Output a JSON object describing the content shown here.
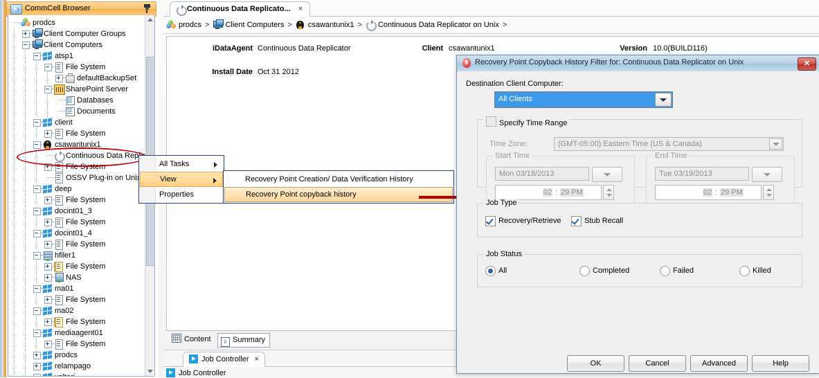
{
  "left_panel": {
    "title": "CommCell Browser",
    "pin_icon": "pin-icon",
    "tree": [
      {
        "label": "prodcs",
        "depth": 0,
        "icon": "commcell-icon",
        "expander": "none"
      },
      {
        "label": "Client Computer Groups",
        "depth": 1,
        "icon": "computer-group-icon",
        "expander": "plus"
      },
      {
        "label": "Client Computers",
        "depth": 1,
        "icon": "computer-group-icon",
        "expander": "minus"
      },
      {
        "label": "atsp1",
        "depth": 2,
        "icon": "windows-client-icon",
        "expander": "minus"
      },
      {
        "label": "File System",
        "depth": 3,
        "icon": "file-system-icon",
        "expander": "minus"
      },
      {
        "label": "defaultBackupSet",
        "depth": 4,
        "icon": "backupset-icon",
        "expander": "plus"
      },
      {
        "label": "SharePoint Server",
        "depth": 3,
        "icon": "sharepoint-icon",
        "expander": "minus"
      },
      {
        "label": "Databases",
        "depth": 4,
        "icon": "database-icon",
        "expander": "none"
      },
      {
        "label": "Documents",
        "depth": 4,
        "icon": "documents-icon",
        "expander": "none"
      },
      {
        "label": "client",
        "depth": 2,
        "icon": "windows-client-icon",
        "expander": "minus"
      },
      {
        "label": "File System",
        "depth": 3,
        "icon": "file-system-icon",
        "expander": "plus"
      },
      {
        "label": "csawantunix1",
        "depth": 2,
        "icon": "linux-client-icon",
        "expander": "minus"
      },
      {
        "label": "Continuous Data Replicator",
        "depth": 3,
        "icon": "cdr-icon",
        "expander": "none"
      },
      {
        "label": "File System",
        "depth": 3,
        "icon": "file-system-icon",
        "expander": "plus"
      },
      {
        "label": "OSSV Plug-in on Unix",
        "depth": 3,
        "icon": "file-system-icon",
        "expander": "none"
      },
      {
        "label": "deep",
        "depth": 2,
        "icon": "windows-client-icon",
        "expander": "minus"
      },
      {
        "label": "File System",
        "depth": 3,
        "icon": "file-system-icon",
        "expander": "plus"
      },
      {
        "label": "docint01_3",
        "depth": 2,
        "icon": "windows-client-icon",
        "expander": "minus"
      },
      {
        "label": "File System",
        "depth": 3,
        "icon": "file-system-icon",
        "expander": "plus"
      },
      {
        "label": "docint01_4",
        "depth": 2,
        "icon": "windows-client-icon",
        "expander": "minus"
      },
      {
        "label": "File System",
        "depth": 3,
        "icon": "file-system-icon",
        "expander": "plus"
      },
      {
        "label": "hfiler1",
        "depth": 2,
        "icon": "filer-icon",
        "expander": "minus"
      },
      {
        "label": "File System",
        "depth": 3,
        "icon": "file-system-yellow-icon",
        "expander": "plus"
      },
      {
        "label": "NAS",
        "depth": 3,
        "icon": "nas-icon",
        "expander": "plus"
      },
      {
        "label": "ma01",
        "depth": 2,
        "icon": "windows-client-icon",
        "expander": "minus"
      },
      {
        "label": "File System",
        "depth": 3,
        "icon": "file-system-icon",
        "expander": "plus"
      },
      {
        "label": "ma02",
        "depth": 2,
        "icon": "windows-client-icon",
        "expander": "minus"
      },
      {
        "label": "File System",
        "depth": 3,
        "icon": "file-system-yellow-icon",
        "expander": "plus"
      },
      {
        "label": "mediaagent01",
        "depth": 2,
        "icon": "windows-client-icon",
        "expander": "minus"
      },
      {
        "label": "File System",
        "depth": 3,
        "icon": "file-system-icon",
        "expander": "plus"
      },
      {
        "label": "prodcs",
        "depth": 2,
        "icon": "windows-client-icon",
        "expander": "plus"
      },
      {
        "label": "relampago",
        "depth": 2,
        "icon": "windows-client-icon",
        "expander": "plus"
      },
      {
        "label": "valtari",
        "depth": 2,
        "icon": "windows-client-icon",
        "expander": "minus"
      }
    ]
  },
  "main": {
    "tab": {
      "label": "Continuous Data Replicato...",
      "close": "×",
      "icon": "cdr-icon"
    },
    "breadcrumb": [
      {
        "label": "prodcs",
        "icon": "commcell-icon"
      },
      {
        "label": "Client Computers",
        "icon": "computer-group-icon"
      },
      {
        "label": "csawantunix1",
        "icon": "linux-client-icon"
      },
      {
        "label": "Continuous Data Replicator on Unix",
        "icon": "cdr-icon"
      }
    ],
    "breadcrumb_separator": ">",
    "details": {
      "idataagent_label": "iDataAgent",
      "idataagent_value": "Continuous Data Replicator",
      "install_date_label": "Install Date",
      "install_date_value": "Oct 31 2012",
      "client_label": "Client",
      "client_value": "csawantunix1",
      "version_label": "Version",
      "version_value": "10.0(BUILD116)"
    },
    "content_tabs": [
      {
        "label": "Content",
        "icon": "grid-icon",
        "selected": false
      },
      {
        "label": "Summary",
        "icon": "summary-icon",
        "selected": true
      }
    ],
    "job_controller_tab": {
      "label": "Job Controller",
      "close": "×",
      "icon": "play-icon"
    },
    "job_controller_bottom": {
      "label": "Job Controller",
      "icon": "play-icon"
    }
  },
  "context_menu_1": {
    "items": [
      {
        "label": "All Tasks",
        "submenu": true,
        "highlighted": false
      },
      {
        "label": "View",
        "submenu": true,
        "highlighted": true
      },
      {
        "label": "Properties",
        "submenu": false,
        "highlighted": false
      }
    ]
  },
  "context_menu_2": {
    "items": [
      {
        "label": "Recovery Point Creation/ Data Verification History",
        "highlighted": false
      },
      {
        "label": "Recovery Point copyback history",
        "highlighted": true
      }
    ]
  },
  "dialog": {
    "title": "Recovery Point Copyback History Filter for: Continuous Data Replicator on Unix",
    "icon": "commvault-icon",
    "close_label": "✕",
    "destination_label": "Destination Client Computer:",
    "destination_value": "All Clients",
    "specify_time_range": {
      "label": "Specify Time Range",
      "checked": false
    },
    "time_zone_label": "Time Zone:",
    "time_zone_value": "(GMT-05:00) Eastern Time (US & Canada)",
    "start_time": {
      "group_label": "Start Time",
      "date": "Mon 03/18/2013",
      "hour": "02",
      "minute": "29 PM",
      "separator": ":"
    },
    "end_time": {
      "group_label": "End Time",
      "date": "Tue 03/19/2013",
      "hour": "02",
      "minute": "29 PM",
      "separator": ":"
    },
    "job_type": {
      "group_label": "Job Type",
      "options": [
        {
          "label": "Recovery/Retrieve",
          "checked": true
        },
        {
          "label": "Stub Recall",
          "checked": true
        }
      ]
    },
    "job_status": {
      "group_label": "Job Status",
      "options": [
        {
          "label": "All",
          "selected": true
        },
        {
          "label": "Completed",
          "selected": false
        },
        {
          "label": "Failed",
          "selected": false
        },
        {
          "label": "Killed",
          "selected": false
        }
      ]
    },
    "buttons": [
      {
        "label": "OK"
      },
      {
        "label": "Cancel"
      },
      {
        "label": "Advanced"
      },
      {
        "label": "Help"
      }
    ]
  },
  "annotations": {
    "ellipse_target": "Continuous Data Replicator tree node",
    "arrow_color": "#b00000"
  }
}
